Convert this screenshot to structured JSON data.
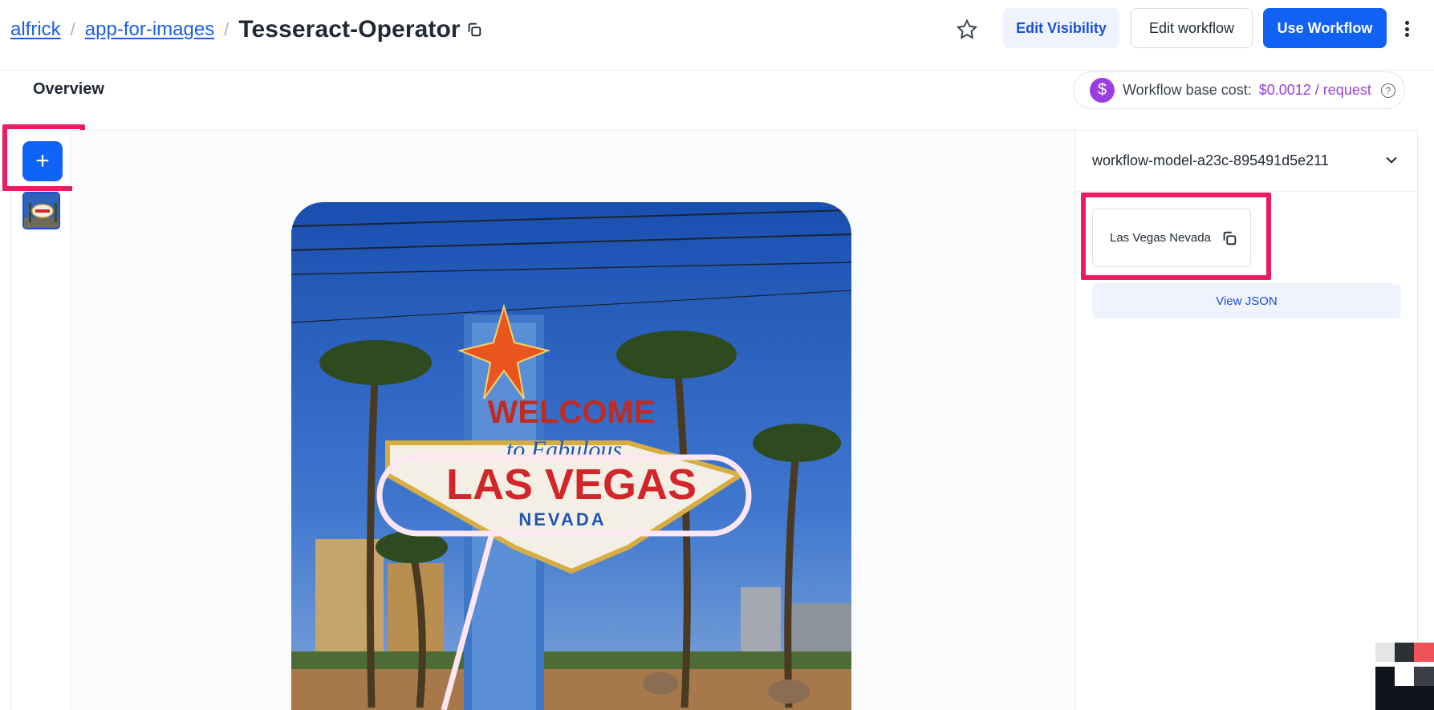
{
  "header": {
    "breadcrumb": [
      {
        "label": "alfrick"
      },
      {
        "label": "app-for-images"
      }
    ],
    "title": "Tesseract-Operator",
    "buttons": {
      "edit_visibility": "Edit Visibility",
      "edit_workflow": "Edit workflow",
      "use_workflow": "Use Workflow"
    },
    "icons": [
      "copy-icon",
      "star-icon",
      "kebab-menu-icon"
    ]
  },
  "subbar": {
    "tab": "Overview",
    "cost": {
      "dollar_symbol": "$",
      "label": "Workflow base cost:",
      "value": "$0.0012 / request",
      "help_symbol": "?"
    }
  },
  "left_rail": {
    "add_symbol": "+",
    "thumbnail_alt": "Las Vegas sign thumbnail"
  },
  "image": {
    "sign_top": "WELCOME",
    "sign_script": "to Fabulous",
    "sign_main": "LAS VEGAS",
    "sign_sub": "NEVADA"
  },
  "right_panel": {
    "model_name": "workflow-model-a23c-895491d5e211",
    "result_text": "Las Vegas Nevada",
    "view_json": "View JSON"
  },
  "colors": {
    "accent": "#1161f5",
    "highlight": "#ec1c5e",
    "cost": "#9b3ee0"
  }
}
